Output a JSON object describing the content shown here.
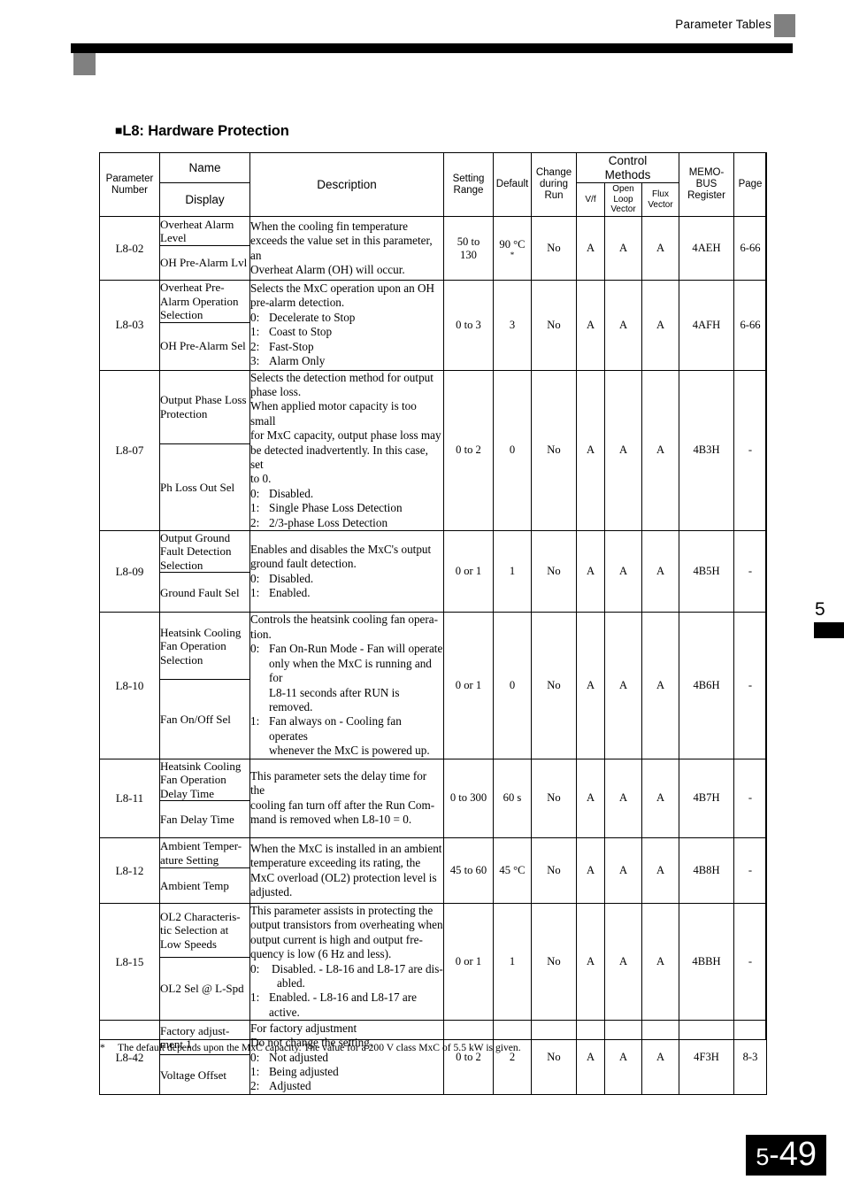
{
  "header": {
    "title": "Parameter Tables"
  },
  "section": {
    "bullet": "■",
    "heading": "L8: Hardware Protection"
  },
  "chapter": {
    "number": "5"
  },
  "footer": {
    "chapter": "5",
    "separator": "-",
    "page": "49"
  },
  "footnote": {
    "mark": "*",
    "text": "The default depends upon the MxC capacity. The value for a 200 V class MxC of 5.5 kW is given."
  },
  "table": {
    "headers": {
      "parameter_number": "Parameter\nNumber",
      "parameter_number_l1": "Parameter",
      "parameter_number_l2": "Number",
      "name": "Name",
      "display": "Display",
      "description": "Description",
      "setting_range_l1": "Setting",
      "setting_range_l2": "Range",
      "default": "Default",
      "change_during_run_l1": "Change",
      "change_during_run_l2": "during",
      "change_during_run_l3": "Run",
      "control_methods_l1": "Control",
      "control_methods_l2": "Methods",
      "vf": "V/f",
      "open_loop_vector_l1": "Open",
      "open_loop_vector_l2": "Loop",
      "open_loop_vector_l3": "Vector",
      "flux_vector_l1": "Flux",
      "flux_vector_l2": "Vector",
      "memobus_register_l1": "MEMO-",
      "memobus_register_l2": "BUS",
      "memobus_register_l3": "Register",
      "page": "Page"
    },
    "rows": [
      {
        "parameter_number": "L8-02",
        "name": "Overheat Alarm Level",
        "display": "OH Pre-Alarm Lvl",
        "description_lines": [
          "When the cooling fin temperature",
          "exceeds the value set in this parameter, an",
          "Overheat Alarm (OH) will occur."
        ],
        "options": [],
        "setting_range": "50 to 130",
        "setting_range_l1": "50 to",
        "setting_range_l2": "130",
        "default": "90 °C",
        "default_note": "*",
        "change_during_run": "No",
        "vf": "A",
        "open_loop_vector": "A",
        "flux_vector": "A",
        "memobus_register": "4AEH",
        "page": "6-66"
      },
      {
        "parameter_number": "L8-03",
        "name": "Overheat Pre-Alarm Operation Selection",
        "display": "OH Pre-Alarm Sel",
        "description_lines": [
          "Selects the MxC operation upon an OH",
          "pre-alarm detection."
        ],
        "options": [
          {
            "key": "0:",
            "text": "Decelerate to Stop"
          },
          {
            "key": "1:",
            "text": "Coast to Stop"
          },
          {
            "key": "2:",
            "text": "Fast-Stop"
          },
          {
            "key": "3:",
            "text": "Alarm Only"
          }
        ],
        "setting_range": "0 to 3",
        "default": "3",
        "default_note": "",
        "change_during_run": "No",
        "vf": "A",
        "open_loop_vector": "A",
        "flux_vector": "A",
        "memobus_register": "4AFH",
        "page": "6-66"
      },
      {
        "parameter_number": "L8-07",
        "name": "Output Phase Loss Protection",
        "display": "Ph Loss Out Sel",
        "description_lines": [
          "Selects the detection method for output",
          "phase loss.",
          "When applied motor capacity is too small",
          "for MxC capacity, output phase loss may",
          "be detected inadvertently. In this case, set",
          "to 0."
        ],
        "options": [
          {
            "key": "0:",
            "text": "Disabled."
          },
          {
            "key": "1:",
            "text": "Single Phase Loss Detection"
          },
          {
            "key": "2:",
            "text": "2/3-phase Loss Detection"
          }
        ],
        "setting_range": "0 to 2",
        "default": "0",
        "default_note": "",
        "change_during_run": "No",
        "vf": "A",
        "open_loop_vector": "A",
        "flux_vector": "A",
        "memobus_register": "4B3H",
        "page": "-"
      },
      {
        "parameter_number": "L8-09",
        "name": "Output Ground Fault Detection Selection",
        "display": "Ground Fault Sel",
        "description_lines": [
          "Enables and disables the MxC's output",
          "ground fault detection."
        ],
        "options": [
          {
            "key": "0:",
            "text": "Disabled."
          },
          {
            "key": "1:",
            "text": "Enabled."
          }
        ],
        "setting_range": "0 or 1",
        "default": "1",
        "default_note": "",
        "change_during_run": "No",
        "vf": "A",
        "open_loop_vector": "A",
        "flux_vector": "A",
        "memobus_register": "4B5H",
        "page": "-"
      },
      {
        "parameter_number": "L8-10",
        "name": "Heatsink Cooling Fan Operation Selection",
        "display": "Fan On/Off Sel",
        "description_lines": [
          "Controls the heatsink cooling fan opera-",
          "tion."
        ],
        "options": [
          {
            "key": "0:",
            "text": "Fan On-Run Mode - Fan will operate",
            "continuation": [
              "only when the MxC is running and for",
              "L8-11 seconds after RUN is removed."
            ]
          },
          {
            "key": "1:",
            "text": "Fan always on - Cooling fan operates",
            "continuation": [
              "whenever the MxC is powered up."
            ]
          }
        ],
        "setting_range": "0 or 1",
        "default": "0",
        "default_note": "",
        "change_during_run": "No",
        "vf": "A",
        "open_loop_vector": "A",
        "flux_vector": "A",
        "memobus_register": "4B6H",
        "page": "-"
      },
      {
        "parameter_number": "L8-11",
        "name": "Heatsink Cooling Fan Operation Delay Time",
        "display": "Fan Delay Time",
        "description_lines": [
          "This parameter sets the delay time for the",
          "cooling fan turn off after the Run Com-",
          "mand is removed when L8-10 = 0."
        ],
        "options": [],
        "setting_range": "0 to 300",
        "default": "60 s",
        "default_note": "",
        "change_during_run": "No",
        "vf": "A",
        "open_loop_vector": "A",
        "flux_vector": "A",
        "memobus_register": "4B7H",
        "page": "-"
      },
      {
        "parameter_number": "L8-12",
        "name": "Ambient Temper-ature Setting",
        "display": "Ambient Temp",
        "description_lines": [
          "When the MxC is installed in an ambient",
          "temperature exceeding its rating, the",
          "MxC overload (OL2) protection level is",
          "adjusted."
        ],
        "options": [],
        "setting_range": "45 to 60",
        "default": "45 °C",
        "default_note": "",
        "change_during_run": "No",
        "vf": "A",
        "open_loop_vector": "A",
        "flux_vector": "A",
        "memobus_register": "4B8H",
        "page": "-"
      },
      {
        "parameter_number": "L8-15",
        "name": "OL2 Characteris-tic Selection at Low Speeds",
        "display": "OL2 Sel @ L-Spd",
        "description_lines": [
          "This parameter assists in protecting the",
          "output transistors from overheating when",
          "output current is high and output fre-",
          "quency is low (6 Hz and less)."
        ],
        "options": [
          {
            "key": "0:",
            "text": "Disabled. - L8-16 and L8-17 are dis-",
            "continuation": [
              "abled."
            ]
          },
          {
            "key": "1:",
            "text": "Enabled. - L8-16 and L8-17 are",
            "continuation": [
              "active."
            ]
          }
        ],
        "setting_range": "0 or 1",
        "default": "1",
        "default_note": "",
        "change_during_run": "No",
        "vf": "A",
        "open_loop_vector": "A",
        "flux_vector": "A",
        "memobus_register": "4BBH",
        "page": "-"
      },
      {
        "parameter_number": "L8-42",
        "name": "Factory adjust-ment 1",
        "display": "Voltage Offset",
        "description_lines": [
          "For factory adjustment",
          "Do not change the setting."
        ],
        "options": [
          {
            "key": "0:",
            "text": "Not adjusted"
          },
          {
            "key": "1:",
            "text": "Being adjusted"
          },
          {
            "key": "2:",
            "text": "Adjusted"
          }
        ],
        "setting_range": "0 to 2",
        "default": "2",
        "default_note": "",
        "change_during_run": "No",
        "vf": "A",
        "open_loop_vector": "A",
        "flux_vector": "A",
        "memobus_register": "4F3H",
        "page": "8-3"
      }
    ]
  }
}
